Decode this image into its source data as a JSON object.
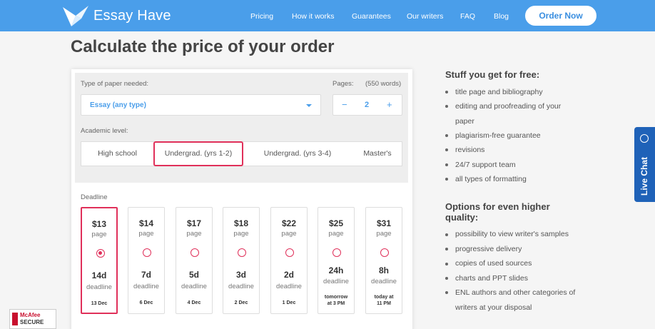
{
  "header": {
    "brand": "Essay Have",
    "nav": [
      "Pricing",
      "How it works",
      "Guarantees",
      "Our writers",
      "FAQ",
      "Blog"
    ],
    "order_button": "Order Now",
    "bg_color": "#4a9eea"
  },
  "page_title": "Calculate the price of your order",
  "calculator": {
    "paper_type_label": "Type of paper needed:",
    "paper_type_value": "Essay (any type)",
    "pages_label": "Pages:",
    "pages_words": "(550 words)",
    "pages_value": "2",
    "minus": "−",
    "plus": "+",
    "academic_level_label": "Academic level:",
    "levels": [
      "High school",
      "Undergrad. (yrs 1-2)",
      "Undergrad. (yrs 3-4)",
      "Master's"
    ],
    "selected_level": "Undergrad. (yrs 1-2)",
    "deadline_label": "Deadline",
    "deadlines": [
      {
        "price": "$13",
        "per": "page",
        "days": "14d",
        "word": "deadline",
        "date": "13 Dec",
        "selected": true
      },
      {
        "price": "$14",
        "per": "page",
        "days": "7d",
        "word": "deadline",
        "date": "6 Dec",
        "selected": false
      },
      {
        "price": "$17",
        "per": "page",
        "days": "5d",
        "word": "deadline",
        "date": "4 Dec",
        "selected": false
      },
      {
        "price": "$18",
        "per": "page",
        "days": "3d",
        "word": "deadline",
        "date": "2 Dec",
        "selected": false
      },
      {
        "price": "$22",
        "per": "page",
        "days": "2d",
        "word": "deadline",
        "date": "1 Dec",
        "selected": false
      },
      {
        "price": "$25",
        "per": "page",
        "days": "24h",
        "word": "deadline",
        "date": "tomorrow at 3 PM",
        "selected": false
      },
      {
        "price": "$31",
        "per": "page",
        "days": "8h",
        "word": "deadline",
        "date": "today at 11 PM",
        "selected": false
      }
    ],
    "accent_color": "#e0305a"
  },
  "free_section": {
    "title": "Stuff you get for free:",
    "items": [
      "title page and bibliography",
      "editing and proofreading of your",
      "paper",
      "plagiarism-free guarantee",
      "revisions",
      "24/7 support team",
      "all types of formatting"
    ]
  },
  "options_section": {
    "title_line1": "Options for even higher",
    "title_line2": "quality:",
    "items": [
      "possibility to view writer's samples",
      "progressive delivery",
      "copies of used sources",
      "charts and PPT slides",
      "ENL authors and other categories of",
      "writers at your disposal"
    ]
  },
  "live_chat": "Live Chat",
  "badge": {
    "line1": "McAfee",
    "line2": "SECURE"
  }
}
